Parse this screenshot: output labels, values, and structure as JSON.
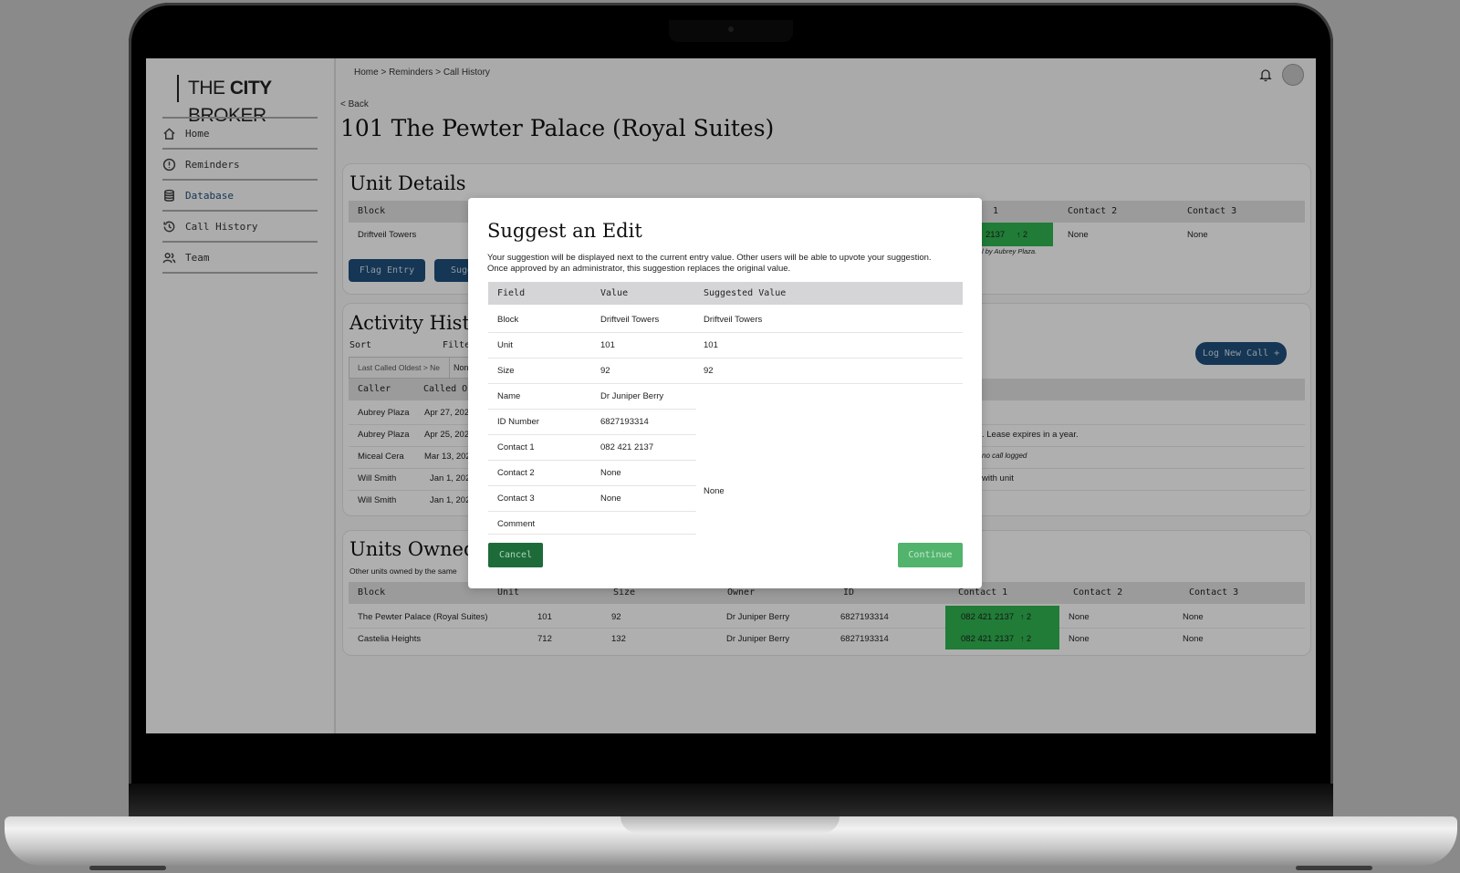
{
  "sidebar": {
    "logo_prefix": "THE ",
    "logo_bold": "CITY",
    "logo_suffix": " BROKER",
    "items": [
      {
        "label": "Home",
        "icon": "home-icon"
      },
      {
        "label": "Reminders",
        "icon": "alert-circle-icon"
      },
      {
        "label": "Database",
        "icon": "database-icon"
      },
      {
        "label": "Call History",
        "icon": "history-icon"
      },
      {
        "label": "Team",
        "icon": "users-icon"
      }
    ]
  },
  "header": {
    "breadcrumb": "Home > Reminders > Call History",
    "back": "< Back",
    "title": "101 The Pewter Palace (Royal Suites)"
  },
  "unit_details": {
    "heading": "Unit Details",
    "col_block": "Block",
    "col_contact1_partial": "1",
    "col_contact2": "Contact 2",
    "col_contact3": "Contact 3",
    "block_value": "Driftveil Towers",
    "contact1_partial": "2137",
    "contact1_votes": "↑ 2",
    "contact2_value": "None",
    "contact3_value": "None",
    "note_partial": "l by Aubrey Plaza.",
    "flag_button": "Flag Entry",
    "suggest_button_partial": "Sugg"
  },
  "activity": {
    "heading_partial": "Activity Histo",
    "sort_label": "Sort",
    "filter_label_partial": "Filte",
    "sort_value": "Last Called Oldest > Ne",
    "filter_value_partial": "Non",
    "log_button": "Log New Call +",
    "col_caller": "Caller",
    "col_called_partial": "Called O",
    "rows": [
      {
        "caller": "Aubrey Plaza",
        "date": "Apr 27, 202",
        "comment": ""
      },
      {
        "caller": "Aubrey Plaza",
        "date": "Apr 25, 202",
        "comment": ". Lease expires in a year."
      },
      {
        "caller": "Miceal Cera",
        "date": "Mar 13, 202",
        "comment": "no call logged"
      },
      {
        "caller": "Will Smith",
        "date": "Jan 1, 202",
        "comment": "with unit"
      },
      {
        "caller": "Will Smith",
        "date": "Jan 1, 202",
        "comment": ""
      }
    ]
  },
  "units_owned": {
    "heading": "Units Owned",
    "subtitle_partial": "Other units owned by the same",
    "columns": [
      "Block",
      "Unit",
      "Size",
      "Owner",
      "ID",
      "Contact 1",
      "Contact 2",
      "Contact 3"
    ],
    "rows": [
      {
        "block": "The Pewter Palace (Royal Suites)",
        "unit": "101",
        "size": "92",
        "owner": "Dr Juniper Berry",
        "id": "6827193314",
        "contact1": "082 421 2137",
        "votes": "↑ 2",
        "contact2": "None",
        "contact3": "None"
      },
      {
        "block": "Castelia Heights",
        "unit": "712",
        "size": "132",
        "owner": "Dr Juniper Berry",
        "id": "6827193314",
        "contact1": "082 421 2137",
        "votes": "↑ 2",
        "contact2": "None",
        "contact3": "None"
      }
    ]
  },
  "modal": {
    "title": "Suggest an Edit",
    "description": "Your suggestion will be displayed next to the current entry value. Other users will be able to upvote your suggestion. Once approved by an administrator, this suggestion replaces the original value.",
    "col_field": "Field",
    "col_value": "Value",
    "col_suggested": "Suggested Value",
    "rows": [
      {
        "field": "Block",
        "value": "Driftveil Towers",
        "suggested": "Driftveil Towers"
      },
      {
        "field": "Unit",
        "value": "101",
        "suggested": "101"
      },
      {
        "field": "Size",
        "value": "92",
        "suggested": "92"
      },
      {
        "field": "Name",
        "value": "Dr Juniper Berry",
        "suggested": ""
      },
      {
        "field": "ID Number",
        "value": "6827193314",
        "suggested": ""
      },
      {
        "field": "Contact 1",
        "value": "082 421 2137",
        "suggested": ""
      },
      {
        "field": "Contact 2",
        "value": "None",
        "suggested": ""
      },
      {
        "field": "Contact 3",
        "value": "None",
        "suggested": ""
      },
      {
        "field": "Comment",
        "value": "",
        "suggested": ""
      }
    ],
    "merged_suggested": "None",
    "cancel": "Cancel",
    "continue": "Continue"
  },
  "colors": {
    "accent_blue": "#1f4e79",
    "accent_green": "#2fb24f",
    "cancel_green": "#1e6b3a",
    "continue_green": "#52b36d"
  }
}
